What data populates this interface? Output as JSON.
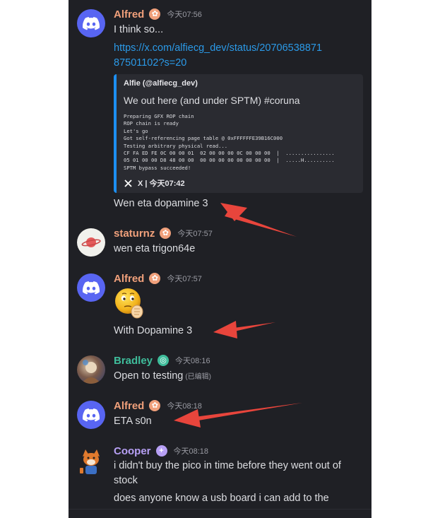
{
  "messages": {
    "m1": {
      "author": "Alfred",
      "time": "今天07:56",
      "text": "I think so...",
      "link": "https://x.com/alfiecg_dev/status/2070653887187501102?s=20",
      "embed": {
        "author": "Alfie (@alfiecg_dev)",
        "description": "We out here (and under SPTM) #coruna",
        "code": "Preparing GFX ROP chain\nROP chain is ready\nLet's go\nGot self-referencing page table @ 0xFFFFFFE39B16C000\nTesting arbitrary physical read...\nCF FA ED FE 0C 00 00 01  02 00 00 00 0C 00 00 00  |  ................\n05 01 00 00 D8 48 00 00  00 00 00 00 00 00 00 00  |  .....H..........\nSPTM bypass succeeded!",
        "footer": "X | 今天07:42"
      },
      "followup": "Wen eta dopamine 3"
    },
    "m2": {
      "author": "staturnz",
      "time": "今天07:57",
      "text": "wen eta trigon64e"
    },
    "m3": {
      "author": "Alfred",
      "time": "今天07:57",
      "text": "With Dopamine 3"
    },
    "m4": {
      "author": "Bradley",
      "time": "今天08:16",
      "text": "Open to testing",
      "edited": "(已编辑)"
    },
    "m5": {
      "author": "Alfred",
      "time": "今天08:18",
      "text": "ETA s0n"
    },
    "m6": {
      "author": "Cooper",
      "time": "今天08:18",
      "text": "i didn't buy the pico in time before they went out of stock",
      "followup": "does anyone know a usb board i can add to the"
    }
  },
  "colors": {
    "background": "#1f2025",
    "link": "#2b9ae8",
    "alfred": "#f0a07b",
    "bradley": "#3fbd9b",
    "cooper": "#b7a0f5",
    "arrow": "#e8453c"
  }
}
